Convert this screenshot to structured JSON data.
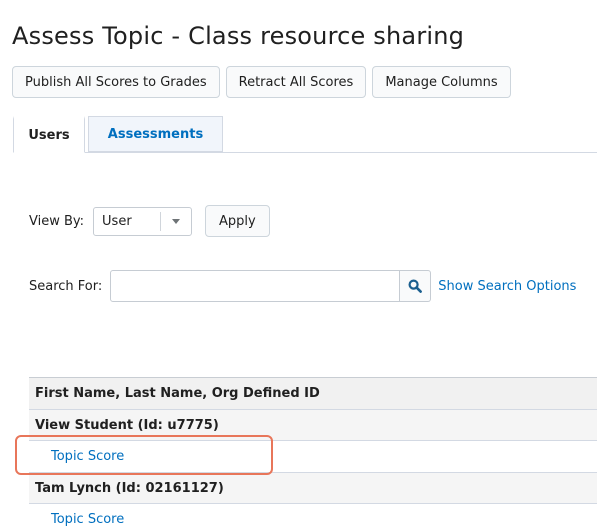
{
  "page": {
    "title": "Assess Topic - Class resource sharing"
  },
  "toolbar": {
    "publish_label": "Publish All Scores to Grades",
    "retract_label": "Retract All Scores",
    "manage_label": "Manage Columns"
  },
  "tabs": [
    {
      "label": "Users",
      "active": true
    },
    {
      "label": "Assessments",
      "active": false
    }
  ],
  "view_by": {
    "label": "View By:",
    "selected": "User",
    "apply_label": "Apply"
  },
  "search": {
    "label": "Search For:",
    "value": "",
    "show_options_label": "Show Search Options"
  },
  "table": {
    "header": "First Name, Last Name, Org Defined ID",
    "groups": [
      {
        "name": "View Student (Id: u7775)",
        "item": "Topic Score"
      },
      {
        "name": "Tam Lynch (Id: 02161127)",
        "item": "Topic Score"
      }
    ]
  },
  "colors": {
    "link": "#006fbf",
    "highlight": "#e8765a"
  }
}
